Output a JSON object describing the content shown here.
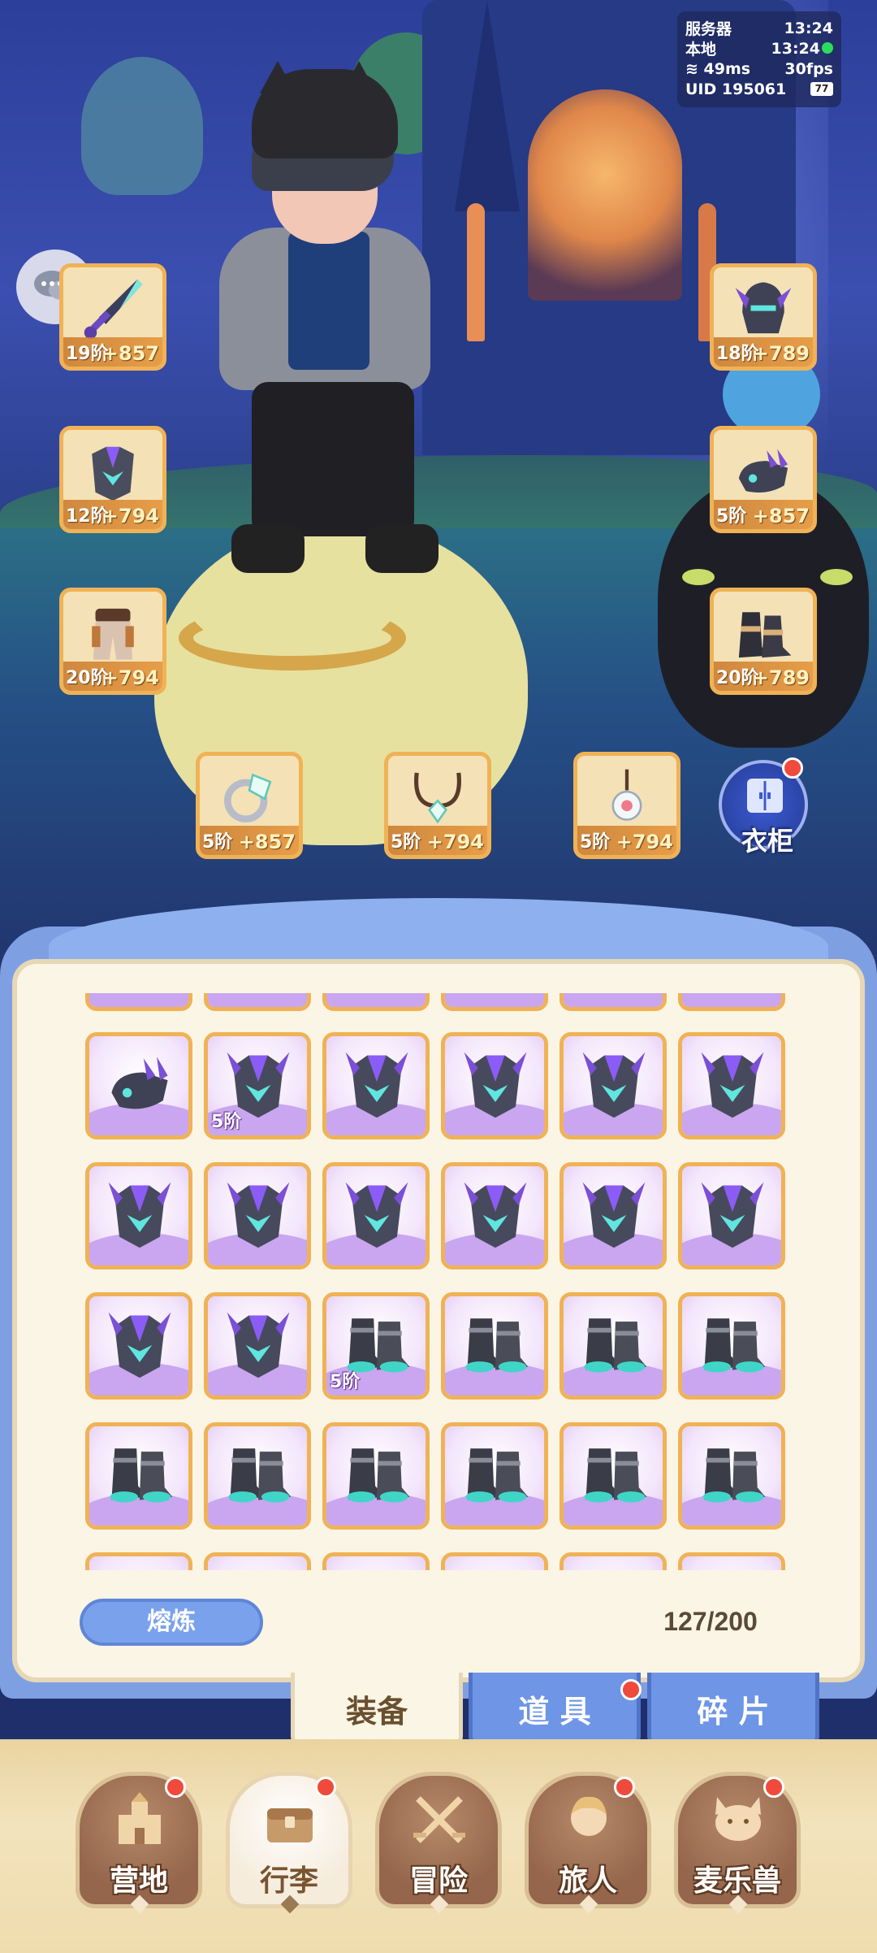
{
  "status": {
    "server_label": "服务器",
    "server_time": "13:24",
    "local_label": "本地",
    "local_time": "13:24",
    "ping": "49ms",
    "fps": "30fps",
    "uid_label": "UID",
    "uid": "195061",
    "battery": "77"
  },
  "equipment": {
    "left": [
      {
        "name": "weapon",
        "tier": "19阶",
        "power": "+857",
        "icon": "sword-icon"
      },
      {
        "name": "chest",
        "tier": "12阶",
        "power": "+794",
        "icon": "armor-icon"
      },
      {
        "name": "legs",
        "tier": "20阶",
        "power": "+794",
        "icon": "pants-icon"
      }
    ],
    "right": [
      {
        "name": "helmet",
        "tier": "18阶",
        "power": "+789",
        "icon": "helmet-icon"
      },
      {
        "name": "gloves",
        "tier": "5阶",
        "power": "+857",
        "icon": "gauntlet-icon"
      },
      {
        "name": "boots",
        "tier": "20阶",
        "power": "+789",
        "icon": "boots-icon"
      }
    ],
    "accessories": [
      {
        "name": "ring",
        "tier": "5阶",
        "power": "+857",
        "icon": "ring-icon"
      },
      {
        "name": "necklace",
        "tier": "5阶",
        "power": "+794",
        "icon": "necklace-icon"
      },
      {
        "name": "amulet",
        "tier": "5阶",
        "power": "+794",
        "icon": "amulet-icon"
      }
    ],
    "wardrobe_label": "衣柜"
  },
  "inventory": {
    "rows": [
      [
        {
          "icon": "gauntlet-icon",
          "tier": ""
        },
        {
          "icon": "armor-icon",
          "tier": "5阶"
        },
        {
          "icon": "armor-icon",
          "tier": ""
        },
        {
          "icon": "armor-icon",
          "tier": ""
        },
        {
          "icon": "armor-icon",
          "tier": ""
        },
        {
          "icon": "armor-icon",
          "tier": ""
        }
      ],
      [
        {
          "icon": "armor-icon",
          "tier": ""
        },
        {
          "icon": "armor-icon",
          "tier": ""
        },
        {
          "icon": "armor-icon",
          "tier": ""
        },
        {
          "icon": "armor-icon",
          "tier": ""
        },
        {
          "icon": "armor-icon",
          "tier": ""
        },
        {
          "icon": "armor-icon",
          "tier": ""
        }
      ],
      [
        {
          "icon": "armor-icon",
          "tier": ""
        },
        {
          "icon": "armor-icon",
          "tier": ""
        },
        {
          "icon": "boots-icon",
          "tier": "5阶"
        },
        {
          "icon": "boots-icon",
          "tier": ""
        },
        {
          "icon": "boots-icon",
          "tier": ""
        },
        {
          "icon": "boots-icon",
          "tier": ""
        }
      ],
      [
        {
          "icon": "boots-icon",
          "tier": ""
        },
        {
          "icon": "boots-icon",
          "tier": ""
        },
        {
          "icon": "boots-icon",
          "tier": ""
        },
        {
          "icon": "boots-icon",
          "tier": ""
        },
        {
          "icon": "boots-icon",
          "tier": ""
        },
        {
          "icon": "boots-icon",
          "tier": ""
        }
      ]
    ],
    "smelt_label": "熔炼",
    "capacity": "127/200"
  },
  "tabs": [
    {
      "label": "装备",
      "active": true
    },
    {
      "label": "道 具",
      "active": false
    },
    {
      "label": "碎 片",
      "active": false
    }
  ],
  "nav": [
    {
      "label": "营地",
      "icon": "castle-icon",
      "active": false
    },
    {
      "label": "行李",
      "icon": "chest-icon",
      "active": true
    },
    {
      "label": "冒险",
      "icon": "crossed-swords-icon",
      "active": false
    },
    {
      "label": "旅人",
      "icon": "traveler-icon",
      "active": false
    },
    {
      "label": "麦乐兽",
      "icon": "cat-icon",
      "active": false
    }
  ],
  "colors": {
    "slot_border": "#f0b256",
    "panel_blue": "#7f9fe3",
    "notice_red": "#ef4a3c"
  }
}
